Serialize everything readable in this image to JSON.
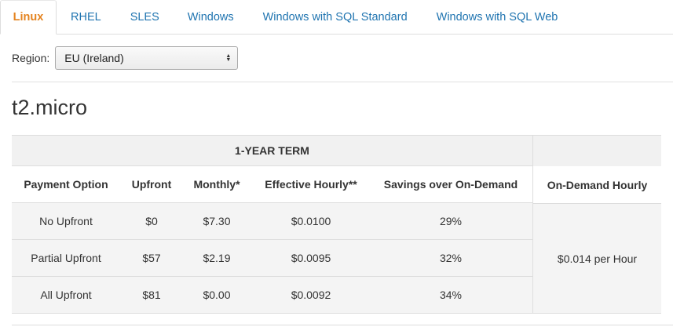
{
  "tabs": [
    {
      "label": "Linux",
      "active": true
    },
    {
      "label": "RHEL",
      "active": false
    },
    {
      "label": "SLES",
      "active": false
    },
    {
      "label": "Windows",
      "active": false
    },
    {
      "label": "Windows with SQL Standard",
      "active": false
    },
    {
      "label": "Windows with SQL Web",
      "active": false
    }
  ],
  "region": {
    "label": "Region:",
    "selected": "EU (Ireland)"
  },
  "instance": {
    "title": "t2.micro"
  },
  "table": {
    "term_header": "1-YEAR TERM",
    "columns": [
      "Payment Option",
      "Upfront",
      "Monthly*",
      "Effective Hourly**",
      "Savings over On-Demand"
    ],
    "ondemand_header": "On-Demand Hourly",
    "ondemand_value": "$0.014 per Hour",
    "rows": [
      [
        "No Upfront",
        "$0",
        "$7.30",
        "$0.0100",
        "29%"
      ],
      [
        "Partial Upfront",
        "$57",
        "$2.19",
        "$0.0095",
        "32%"
      ],
      [
        "All Upfront",
        "$81",
        "$0.00",
        "$0.0092",
        "34%"
      ]
    ]
  },
  "colors": {
    "active_tab": "#e4831f",
    "tab_link": "#1f74b0",
    "header_bg": "#f1f1f1",
    "row_bg": "#f4f4f4",
    "border": "#dddddd"
  }
}
